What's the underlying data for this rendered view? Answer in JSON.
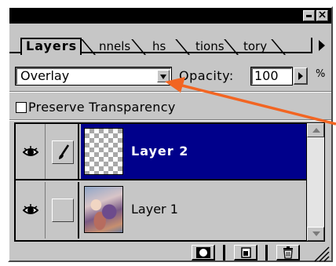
{
  "tabs": [
    {
      "label": "Layers",
      "active": true
    },
    {
      "label": "nnels",
      "active": false
    },
    {
      "label": "hs",
      "active": false
    },
    {
      "label": "tions",
      "active": false
    },
    {
      "label": "tory",
      "active": false
    }
  ],
  "blend_mode": {
    "value": "Overlay"
  },
  "opacity": {
    "label": "Opacity:",
    "value": "100",
    "unit": "%"
  },
  "preserve_transparency": {
    "label": "Preserve Transparency",
    "checked": false
  },
  "layers": [
    {
      "name": "Layer 2",
      "selected": true,
      "visible": true,
      "brush": true,
      "thumbnail": "transparent"
    },
    {
      "name": "Layer 1",
      "selected": false,
      "visible": true,
      "brush": false,
      "thumbnail": "image"
    }
  ],
  "bottom_buttons": [
    {
      "icon": "layer-mask-icon"
    },
    {
      "icon": "new-layer-icon"
    },
    {
      "icon": "trash-icon"
    }
  ],
  "colors": {
    "panel": "#c6c6c6",
    "selection": "#00008b",
    "annotation_arrow": "#f26522"
  }
}
